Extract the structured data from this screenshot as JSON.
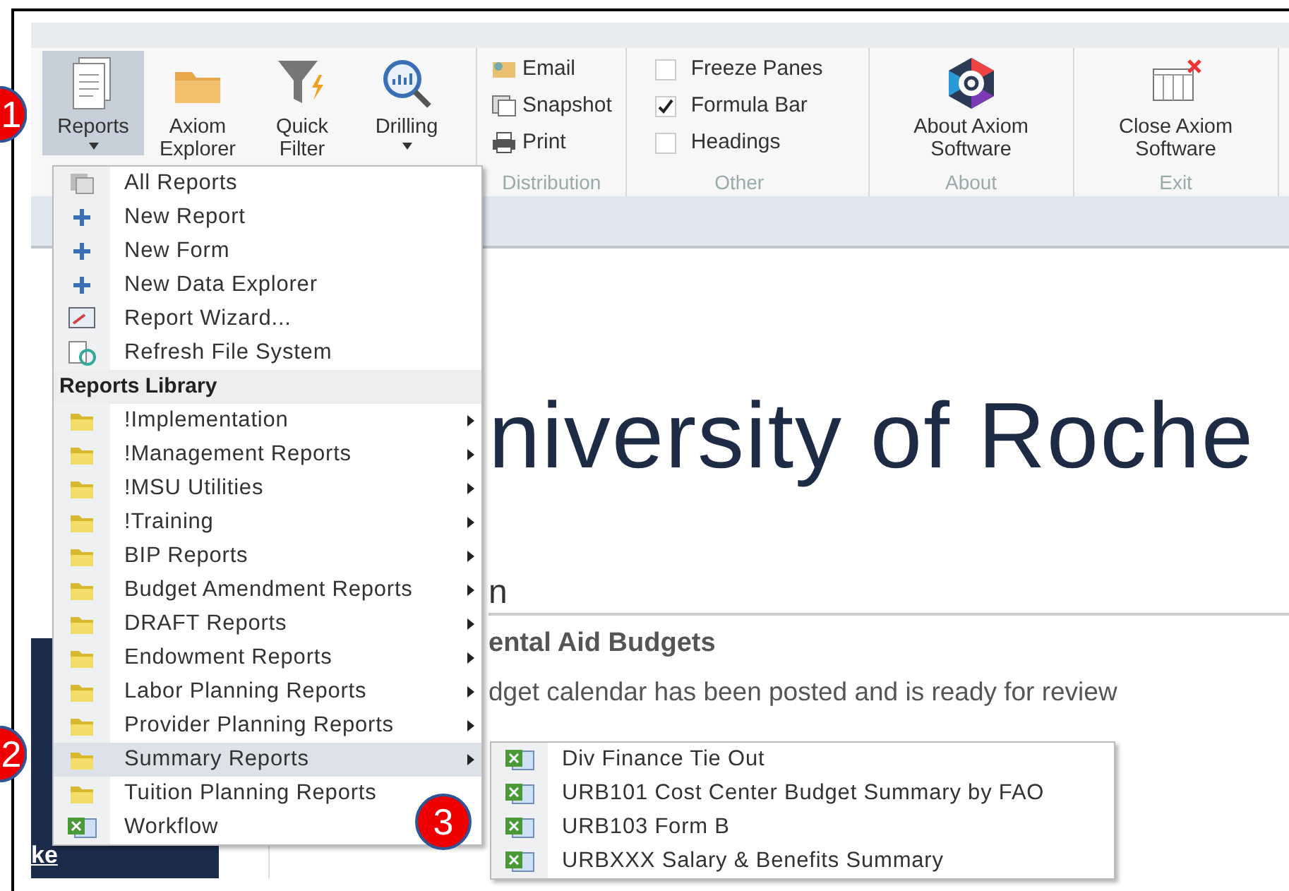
{
  "ribbon": {
    "groups": [
      {
        "kind": "large",
        "buttons": [
          {
            "label": "Reports",
            "selected": true,
            "dropdown": true
          },
          {
            "label": "Axiom Explorer",
            "selected": false,
            "dropdown": false
          },
          {
            "label": "Quick Filter",
            "selected": false,
            "dropdown": false
          },
          {
            "label": "Drilling",
            "selected": false,
            "dropdown": true
          }
        ]
      },
      {
        "kind": "small",
        "label": "Distribution",
        "items": [
          "Email",
          "Snapshot",
          "Print"
        ]
      },
      {
        "kind": "checks",
        "label": "Other",
        "items": [
          {
            "label": "Freeze Panes",
            "checked": false
          },
          {
            "label": "Formula Bar",
            "checked": true
          },
          {
            "label": "Headings",
            "checked": false
          }
        ]
      },
      {
        "kind": "large",
        "label": "About",
        "buttons": [
          {
            "label": "About Axiom Software",
            "selected": false,
            "dropdown": false
          }
        ]
      },
      {
        "kind": "large",
        "label": "Exit",
        "buttons": [
          {
            "label": "Close Axiom Software",
            "selected": false,
            "dropdown": false
          }
        ]
      }
    ]
  },
  "menu": {
    "commands": [
      "All Reports",
      "New Report",
      "New Form",
      "New Data Explorer",
      "Report Wizard...",
      "Refresh File System"
    ],
    "library_header": "Reports Library",
    "library": [
      {
        "label": "!Implementation",
        "kind": "folder",
        "has_submenu": true,
        "selected": false
      },
      {
        "label": "!Management Reports",
        "kind": "folder",
        "has_submenu": true,
        "selected": false
      },
      {
        "label": "!MSU Utilities",
        "kind": "folder",
        "has_submenu": true,
        "selected": false
      },
      {
        "label": "!Training",
        "kind": "folder",
        "has_submenu": true,
        "selected": false
      },
      {
        "label": "BIP Reports",
        "kind": "folder",
        "has_submenu": true,
        "selected": false
      },
      {
        "label": "Budget Amendment Reports",
        "kind": "folder",
        "has_submenu": true,
        "selected": false
      },
      {
        "label": "DRAFT Reports",
        "kind": "folder",
        "has_submenu": true,
        "selected": false
      },
      {
        "label": "Endowment Reports",
        "kind": "folder",
        "has_submenu": true,
        "selected": false
      },
      {
        "label": "Labor Planning Reports",
        "kind": "folder",
        "has_submenu": true,
        "selected": false
      },
      {
        "label": "Provider Planning Reports",
        "kind": "folder",
        "has_submenu": true,
        "selected": false
      },
      {
        "label": "Summary Reports",
        "kind": "folder",
        "has_submenu": true,
        "selected": true
      },
      {
        "label": "Tuition Planning Reports",
        "kind": "folder",
        "has_submenu": false,
        "selected": false
      },
      {
        "label": "Workflow",
        "kind": "workbook",
        "has_submenu": false,
        "selected": false
      }
    ],
    "submenu": [
      "Div Finance Tie Out",
      "URB101 Cost Center Budget Summary by FAO",
      "URB103 Form B",
      "URBXXX Salary & Benefits Summary"
    ]
  },
  "page": {
    "heading": "niversity of Roche",
    "section_heading": "n",
    "subheading": "ental Aid Budgets",
    "text": "dget calendar has been posted and is ready for review",
    "sidebar_link": "ke"
  },
  "callouts": [
    "1",
    "2",
    "3"
  ]
}
